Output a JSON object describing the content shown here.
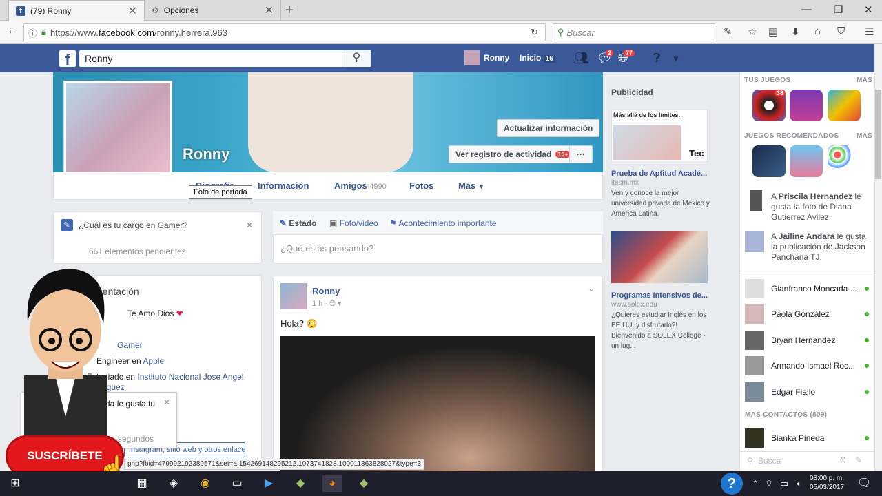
{
  "browser": {
    "tabs": [
      {
        "label": "(79) Ronny",
        "icon": "facebook-icon",
        "active": true
      },
      {
        "label": "Opciones",
        "icon": "gear-icon",
        "active": false
      }
    ],
    "url_prefix": "https://www.",
    "url_domain": "facebook.com",
    "url_path": "/ronny.herrera.963",
    "search_placeholder": "Buscar"
  },
  "fb_header": {
    "search_value": "Ronny",
    "user": "Ronny",
    "home_label": "Inicio",
    "home_count": "16",
    "messages_badge": "2",
    "notifications_badge": "77"
  },
  "profile": {
    "name": "Ronny",
    "update_info": "Actualizar información",
    "activity_log": "Ver registro de actividad",
    "activity_badge": "10+",
    "more_dots": "···",
    "tabs": {
      "bio": "Biografía",
      "info": "Información",
      "friends": "Amigos",
      "friends_count": "4990",
      "photos": "Fotos",
      "more": "Más"
    },
    "tooltip": "Foto de portada"
  },
  "left": {
    "prompt": "¿Cuál es tu cargo en Gamer?",
    "pending": "661 elementos pendientes",
    "intro_title": "Presentación",
    "love_text": "Te Amo Dios",
    "gamer": "Gamer",
    "engineer_text": "Engineer en",
    "engineer_link": "Apple",
    "studied_text": "Estudiado en",
    "studied_link": "Instituto Nacional Jose Angel Rodriguez",
    "notif_text": "Miranda le gusta tu",
    "notif_sub": "segundos",
    "links_btn": "Instagram, sitio web y otros enlaces"
  },
  "composer": {
    "status": "Estado",
    "photo": "Foto/video",
    "event": "Acontecimiento importante",
    "placeholder": "¿Qué estás pensando?"
  },
  "post": {
    "author": "Ronny",
    "time": "1 h",
    "text": "Hola?"
  },
  "ads": {
    "title": "Publicidad",
    "ad1_banner": "Más allá de los límites.",
    "ad1_logo": "Tec",
    "ad1_title": "Prueba de Aptitud Acadé...",
    "ad1_domain": "itesm.mx",
    "ad1_desc": "Ven y conoce la mejor universidad privada de México y América Latina.",
    "ad2_title": "Programas Intensivos de...",
    "ad2_domain": "www.solex.edu",
    "ad2_desc": "¿Quieres estudiar Inglés en los EE.UU. y disfrutarlo?! Bienvenido a SOLEX College - un lug..."
  },
  "sidebar": {
    "your_games": "TUS JUEGOS",
    "more": "MÁS",
    "game_badge": "38",
    "recommended": "JUEGOS RECOMENDADOS",
    "activity": [
      {
        "pre": "A ",
        "name": "Priscila Hernandez",
        "text": " le gusta la foto de Diana Gutierrez Avilez."
      },
      {
        "pre": "A ",
        "name": "Jailine Andara",
        "text": " le gusta la publicación de Jackson Panchana TJ."
      }
    ],
    "contacts": [
      "Gianfranco Moncada ...",
      "Paola González",
      "Bryan Hernandez",
      "Armando Ismael Roc...",
      "Edgar Fiallo"
    ],
    "more_contacts": "MÁS CONTACTOS (809)",
    "more_list": [
      "Bianka Pineda"
    ],
    "search_placeholder": "Busca"
  },
  "status_url": "php?fbid=479992192389571&set=a.154269148295212.1073741828.100011363828027&type=3",
  "overlay": {
    "subscribe": "SUSCRÍBETE"
  },
  "taskbar": {
    "time": "08:00 p. m.",
    "date": "05/03/2017"
  },
  "colors": {
    "fb_blue": "#3b5998",
    "link": "#365899",
    "online": "#42b72a",
    "badge": "#fa3e3e"
  }
}
